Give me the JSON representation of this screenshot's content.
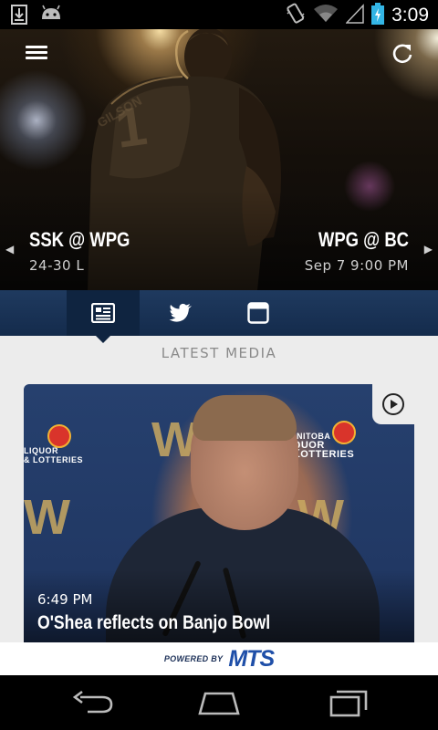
{
  "status_bar": {
    "time": "3:09",
    "icons": [
      "download-icon",
      "android-icon",
      "vibrate-icon",
      "wifi-icon",
      "signal-icon",
      "battery-charging-icon"
    ]
  },
  "hero": {
    "left_game": {
      "matchup": "SSK @ WPG",
      "detail": "24-30 L"
    },
    "right_game": {
      "matchup": "WPG @ BC",
      "detail": "Sep 7 9:00 PM"
    },
    "prev_arrow": "◀",
    "next_arrow": "▶"
  },
  "tabs": [
    {
      "icon": "news-icon",
      "active": true
    },
    {
      "icon": "twitter-icon",
      "active": false
    },
    {
      "icon": "calendar-icon",
      "active": false
    }
  ],
  "section_title": "LATEST MEDIA",
  "media_card": {
    "time": "6:49 PM",
    "title": "O'Shea reflects on Banjo Bowl",
    "backdrop_texts": [
      "MANITOBA",
      "LIQUOR",
      "& LOTTERIES",
      "W"
    ]
  },
  "footer": {
    "powered_label": "POWERED BY",
    "brand": "MTS"
  },
  "colors": {
    "tab_bar": "#1f3a5f",
    "tab_active": "#0f2440",
    "brand_blue": "#1f4fa8",
    "content_bg": "#ececec"
  }
}
